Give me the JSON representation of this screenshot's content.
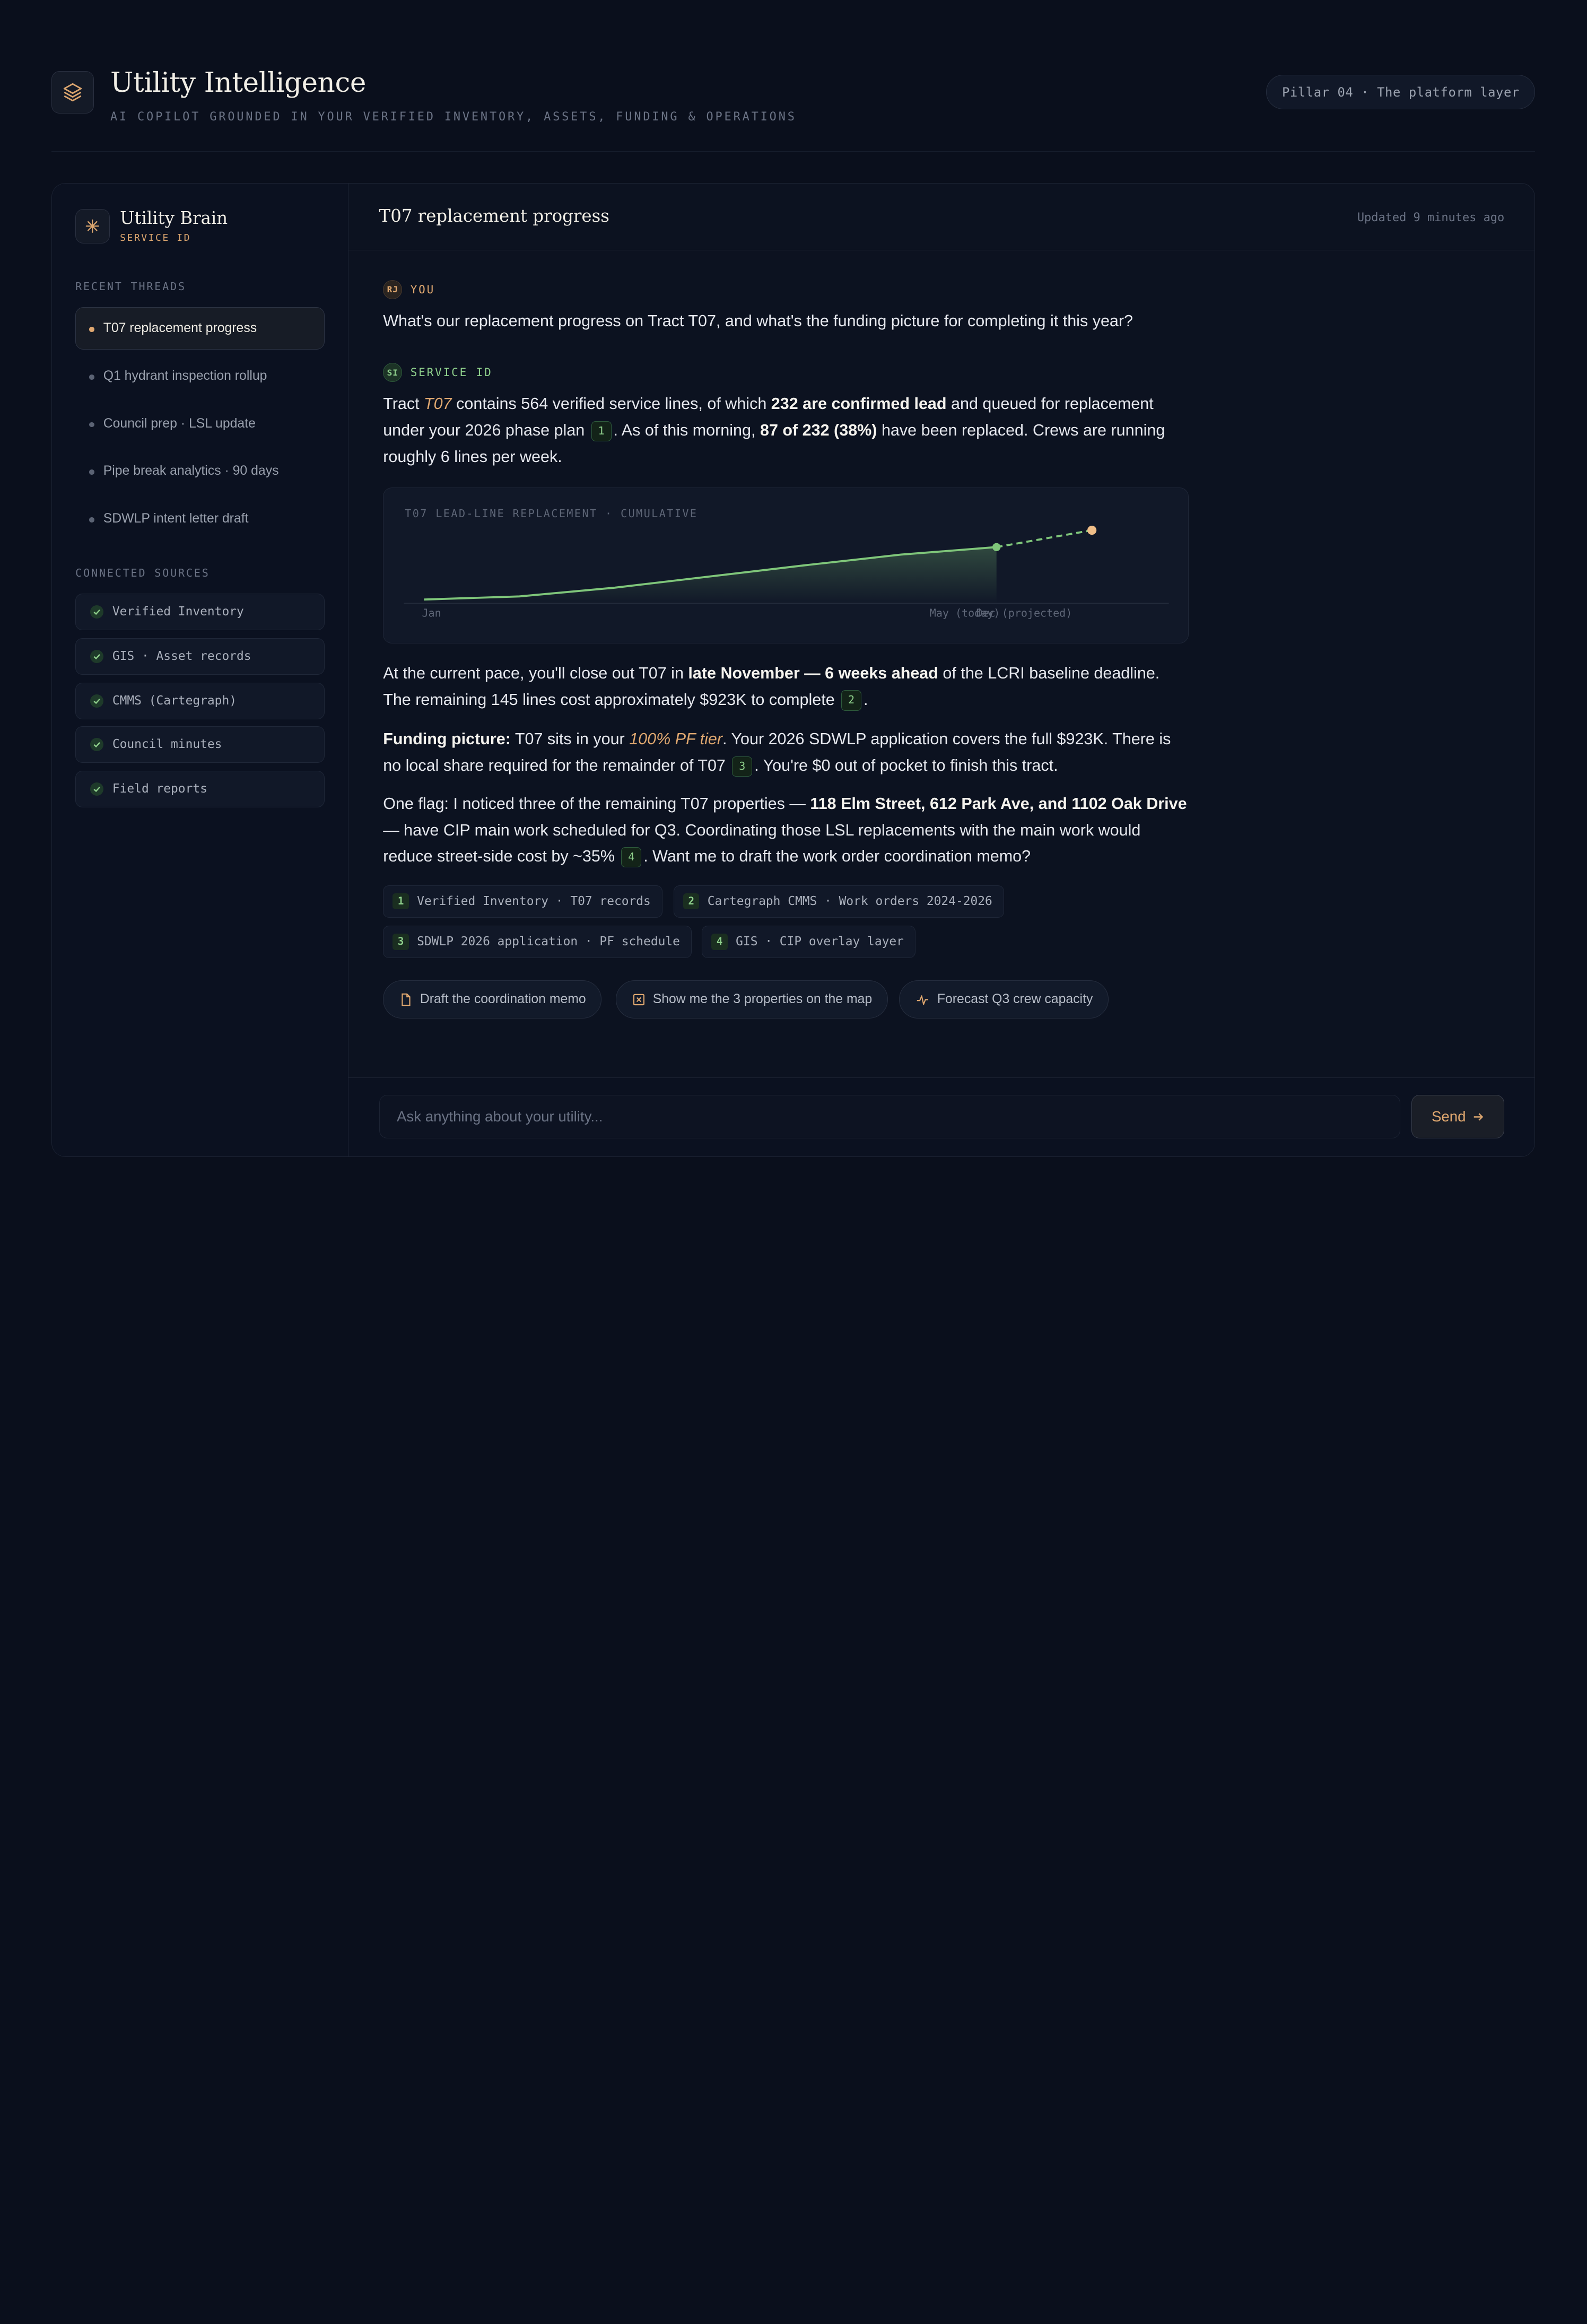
{
  "header": {
    "title": "Utility Intelligence",
    "subtitle": "AI COPILOT GROUNDED IN YOUR VERIFIED INVENTORY, ASSETS, FUNDING & OPERATIONS",
    "pill": "Pillar 04 · The platform layer"
  },
  "sidebar": {
    "brand_name": "Utility Brain",
    "brand_sub": "SERVICE ID",
    "threads_label": "RECENT THREADS",
    "threads": [
      {
        "label": "T07 replacement progress"
      },
      {
        "label": "Q1 hydrant inspection rollup"
      },
      {
        "label": "Council prep · LSL update"
      },
      {
        "label": "Pipe break analytics · 90 days"
      },
      {
        "label": "SDWLP intent letter draft"
      }
    ],
    "sources_label": "CONNECTED SOURCES",
    "sources": [
      {
        "label": "Verified Inventory"
      },
      {
        "label": "GIS · Asset records"
      },
      {
        "label": "CMMS (Cartegraph)"
      },
      {
        "label": "Council minutes"
      },
      {
        "label": "Field reports"
      }
    ]
  },
  "main": {
    "title": "T07 replacement progress",
    "updated": "Updated 9 minutes ago",
    "user": {
      "initials": "RJ",
      "name": "YOU",
      "text": "What's our replacement progress on Tract T07, and what's the funding picture for completing it this year?"
    },
    "assistant": {
      "initials": "SI",
      "name": "SERVICE ID",
      "p1": {
        "a": "Tract ",
        "b": "T07",
        "c": " contains 564 verified service lines, of which ",
        "d": "232 are confirmed lead",
        "e": " and queued for replacement under your 2026 phase plan ",
        "cite": "1",
        "f": ". As of this morning, ",
        "g": "87 of 232 (38%)",
        "h": " have been replaced. Crews are running roughly 6 lines per week."
      },
      "p2": {
        "a": "At the current pace, you'll close out T07 in ",
        "b": "late November — 6 weeks ahead",
        "c": " of the LCRI baseline deadline. The remaining 145 lines cost approximately $923K to complete ",
        "cite": "2",
        "d": "."
      },
      "p3": {
        "a": "Funding picture:",
        "b": " T07 sits in your ",
        "c": "100% PF tier",
        "d": ". Your 2026 SDWLP application covers the full $923K. There is no local share required for the remainder of T07 ",
        "cite": "3",
        "e": ". You're $0 out of pocket to finish this tract."
      },
      "p4": {
        "a": "One flag: I noticed three of the remaining T07 properties — ",
        "b": "118 Elm Street, 612 Park Ave, and 1102 Oak Drive",
        "c": " — have CIP main work scheduled for Q3. Coordinating those LSL replacements with the main work would reduce street-side cost by ~35% ",
        "cite": "4",
        "d": ". Want me to draft the work order coordination memo?"
      },
      "citations": [
        {
          "n": "1",
          "label": "Verified Inventory · T07 records"
        },
        {
          "n": "2",
          "label": "Cartegraph CMMS · Work orders 2024-2026"
        },
        {
          "n": "3",
          "label": "SDWLP 2026 application · PF schedule"
        },
        {
          "n": "4",
          "label": "GIS · CIP overlay layer"
        }
      ],
      "actions": [
        {
          "label": "Draft the coordination memo",
          "icon": "document-icon"
        },
        {
          "label": "Show me the 3 properties on the map",
          "icon": "map-pin-icon"
        },
        {
          "label": "Forecast Q3 crew capacity",
          "icon": "pulse-icon"
        }
      ]
    },
    "composer": {
      "placeholder": "Ask anything about your utility...",
      "send": "Send"
    }
  },
  "colors": {
    "accent": "#e0a870",
    "green": "#7fc67a",
    "bg": "#0a0f1c"
  },
  "chart_data": {
    "type": "line",
    "title": "T07 LEAD-LINE REPLACEMENT · CUMULATIVE",
    "x_labels": [
      "Jan",
      "May (today)",
      "Dec (projected)"
    ],
    "series": [
      {
        "x": [
          0,
          1,
          2,
          3,
          4,
          5,
          6
        ],
        "values": [
          3,
          8,
          22,
          40,
          58,
          75,
          87
        ]
      },
      {
        "x": [
          6,
          7
        ],
        "values": [
          87,
          114
        ]
      }
    ],
    "ylim": [
      0,
      120
    ]
  }
}
